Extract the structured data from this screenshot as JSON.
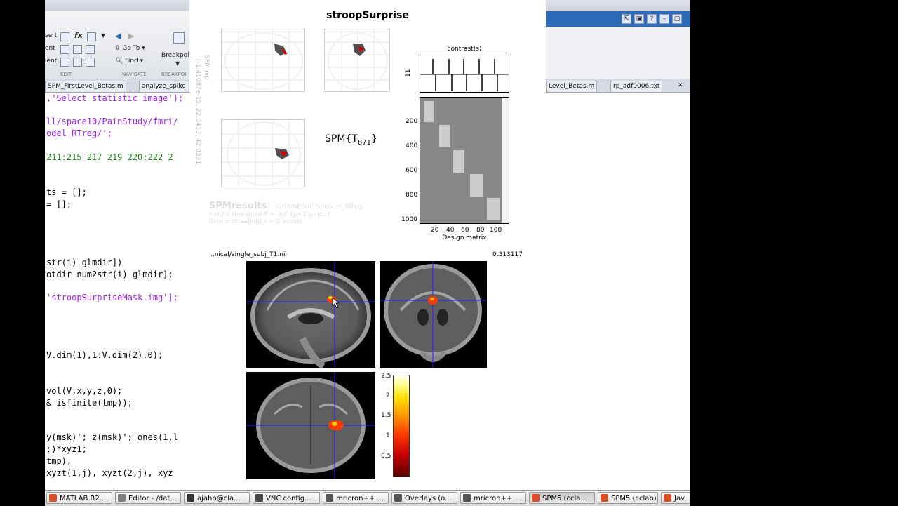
{
  "editor": {
    "ribbon": {
      "insert_label": "sert",
      "comment_label": "ent",
      "indent_label": "lent",
      "fx_label": "fx",
      "goto_label": "Go To",
      "find_label": "Find",
      "breakpoints_label": "Breakpoi",
      "section_edit": "EDIT",
      "section_navigate": "NAVIGATE",
      "section_breakpoints": "BREAKPOI"
    },
    "tabs": [
      "SPM_FirstLevel_Betas.m",
      "analyze_spike"
    ],
    "code_lines": [
      {
        "t": ",'Select statistic image');",
        "c": "s"
      },
      {
        "t": "ll/space10/PainStudy/fmri/",
        "c": "s"
      },
      {
        "t": "odel_RTreg/';",
        "c": "s"
      },
      {
        "t": "211:215 217 219 220:222 2",
        "c": "g"
      },
      {
        "t": "ts = [];",
        "c": "k"
      },
      {
        "t": "= [];",
        "c": "k"
      },
      {
        "t": "str(i) glmdir])",
        "c": "k"
      },
      {
        "t": "otdir num2str(i) glmdir];",
        "c": "k"
      },
      {
        "t": "'stroopSurpriseMask.img'];",
        "c": "s"
      },
      {
        "t": "V.dim(1),1:V.dim(2),0);",
        "c": "k"
      },
      {
        "t": "vol(V,x,y,z,0);",
        "c": "k"
      },
      {
        "t": "& isfinite(tmp));",
        "c": "k"
      },
      {
        "t": "y(msk)'; z(msk)'; ones(1,l",
        "c": "k"
      },
      {
        "t": ":)*xyz1;",
        "c": "k"
      },
      {
        "t": "tmp),",
        "c": "k"
      },
      {
        "t": "xyzt(1,j), xyzt(2,j), xyz",
        "c": "k"
      }
    ]
  },
  "right_editor": {
    "tabs": [
      "Level_Betas.m",
      "rp_adf0006.txt"
    ]
  },
  "spm": {
    "title": "stroopSurprise",
    "mip_label": "SPMmip",
    "mip_coords": "[-1.41087e-15, 22.0413, 42.0391]",
    "stat_label": "SPM{T",
    "stat_df": "871",
    "stat_close": "}",
    "results_title": "SPMresults:",
    "results_path": "./202/RESULTS/model_RTreg",
    "height_threshold": "Height threshold T = -Inf  {p<1 (unc.)}",
    "extent_threshold": "Extent threshold k = 0 voxels",
    "contrast_label": "contrast(s)",
    "contrast_number": "11",
    "design_label": "Design matrix",
    "design_y_ticks": [
      "200",
      "400",
      "600",
      "800",
      "1000"
    ],
    "design_x_ticks": [
      "20",
      "40",
      "60",
      "80",
      "100"
    ],
    "anat_file": "..nical/single_subj_T1.nii",
    "anat_value": "0.313117",
    "colorbar_ticks": [
      "2.5",
      "2",
      "1.5",
      "1",
      "0.5"
    ],
    "colorbar_range": [
      0,
      2.6
    ]
  },
  "taskbar": {
    "items": [
      {
        "label": "MATLAB R2...",
        "color": "#d9502b"
      },
      {
        "label": "Editor - /dat...",
        "color": "#7f7f7f"
      },
      {
        "label": "ajahn@cla...",
        "color": "#333333"
      },
      {
        "label": "VNC config...",
        "color": "#444444"
      },
      {
        "label": "mricron++ ...",
        "color": "#555555"
      },
      {
        "label": "Overlays (o...",
        "color": "#555555"
      },
      {
        "label": "mricron++ ...",
        "color": "#555555"
      },
      {
        "label": "SPM5 (ccla...",
        "color": "#d9502b"
      },
      {
        "label": "SPM5 (cclab)",
        "color": "#d9502b"
      },
      {
        "label": "Jav",
        "color": "#d9502b"
      }
    ]
  },
  "colors": {
    "accent": "#2c6ab7",
    "activation": "#ff3a00",
    "crosshair": "#2020ff"
  }
}
